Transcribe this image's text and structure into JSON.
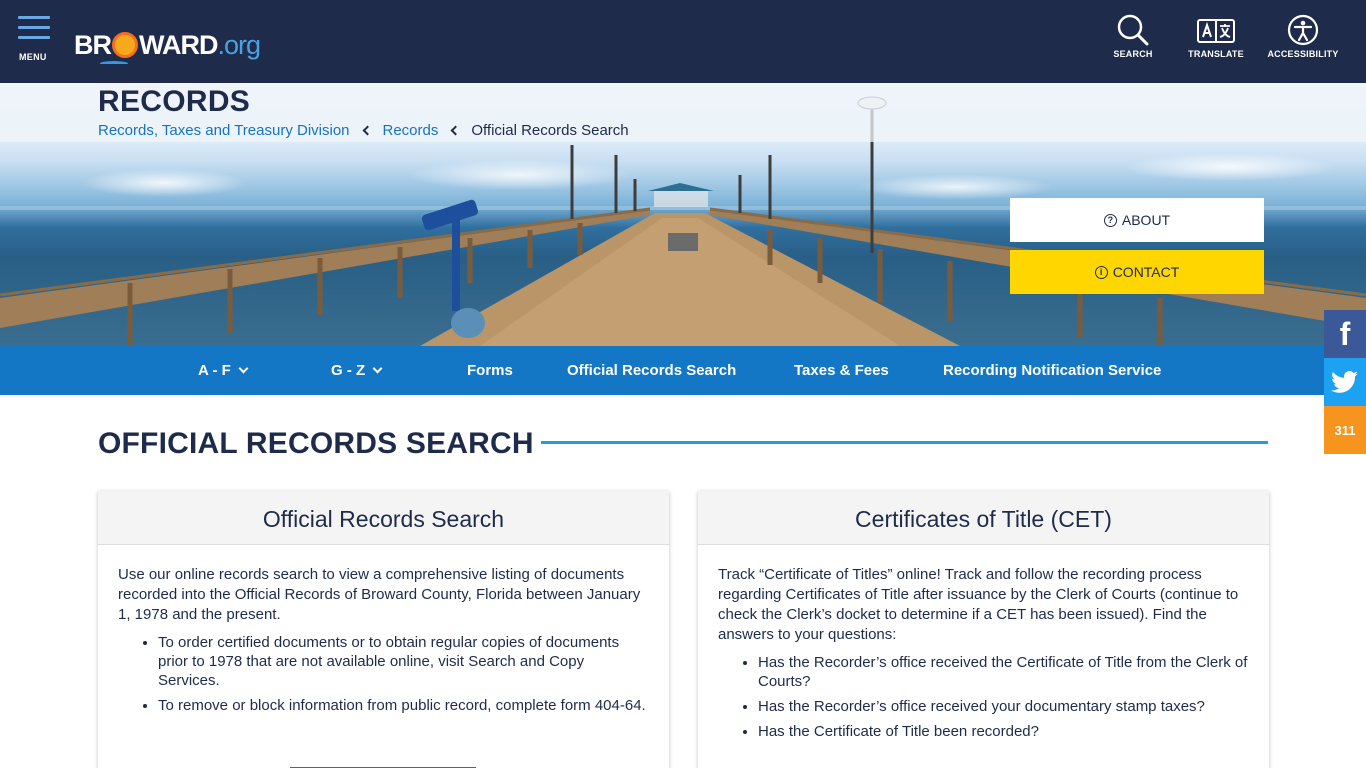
{
  "header": {
    "menu_label": "MENU",
    "logo": {
      "text_pre": "BR",
      "text_mid": "WARD",
      "text_suffix": ".org"
    },
    "utilities": [
      {
        "label": "SEARCH",
        "icon": "search-icon"
      },
      {
        "label": "TRANSLATE",
        "icon": "translate-icon"
      },
      {
        "label": "ACCESSIBILITY",
        "icon": "accessibility-icon"
      }
    ]
  },
  "hero": {
    "title": "RECORDS",
    "breadcrumb": [
      {
        "label": "Records, Taxes and Treasury Division",
        "link": true
      },
      {
        "label": "Records",
        "link": true
      },
      {
        "label": "Official Records Search",
        "link": false
      }
    ],
    "about_label": "ABOUT",
    "contact_label": "CONTACT"
  },
  "section_nav": [
    {
      "label": "A - F",
      "dropdown": true
    },
    {
      "label": "G - Z",
      "dropdown": true
    },
    {
      "label": "Forms",
      "dropdown": false
    },
    {
      "label": "Official Records Search",
      "dropdown": false
    },
    {
      "label": "Taxes & Fees",
      "dropdown": false
    },
    {
      "label": "Recording Notification Service",
      "dropdown": false
    }
  ],
  "social": {
    "facebook": "f",
    "twitter": "twitter-bird-icon",
    "three11": "311"
  },
  "main": {
    "heading": "OFFICIAL RECORDS SEARCH",
    "cards": [
      {
        "title": "Official Records Search",
        "intro": "Use our online records search to view a comprehensive listing of documents recorded into the Official Records of Broward County, Florida between January 1, 1978 and the present.",
        "bullets": [
          "To order certified documents or to obtain regular copies of documents prior to 1978 that are not available online, visit Search and Copy Services.",
          "To remove or block information from public record, complete form 404-64."
        ]
      },
      {
        "title": "Certificates of Title (CET)",
        "intro": "Track “Certificate of Titles” online! Track and follow the recording process regarding Certificates of Title after issuance by the Clerk of Courts (continue to check the Clerk’s docket to determine if a CET has been issued). Find the answers to your questions:",
        "bullets": [
          "Has the Recorder’s office received the Certificate of Title from the Clerk of Courts?",
          "Has the Recorder’s office received your documentary stamp taxes?",
          "Has the Certificate of Title been recorded?"
        ]
      }
    ]
  },
  "colors": {
    "header_bg": "#1e2b4a",
    "nav_blue": "#1377c6",
    "contact_yellow": "#ffd600",
    "rule_blue": "#1f9ee0",
    "facebook": "#3b5998",
    "twitter": "#1da1f2",
    "three11": "#f7941d"
  }
}
